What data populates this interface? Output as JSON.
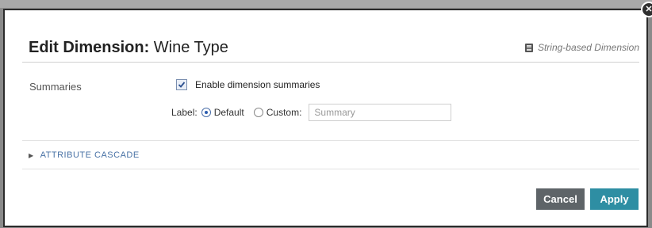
{
  "dialog": {
    "title_bold": "Edit Dimension:",
    "title_name": "Wine Type",
    "type_label": "String-based Dimension",
    "type_icon": "database-icon",
    "close_icon": "close-icon"
  },
  "summaries": {
    "section_label": "Summaries",
    "enable_checked": true,
    "enable_label": "Enable dimension summaries",
    "label_prefix": "Label:",
    "option_default": "Default",
    "option_custom": "Custom:",
    "selected_option": "Default",
    "custom_placeholder": "Summary"
  },
  "cascade": {
    "label": "ATTRIBUTE CASCADE",
    "expanded": false
  },
  "buttons": {
    "cancel": "Cancel",
    "apply": "Apply"
  },
  "colors": {
    "apply": "#2e8ea3",
    "cancel": "#5e6468",
    "link": "#4a73a6"
  }
}
